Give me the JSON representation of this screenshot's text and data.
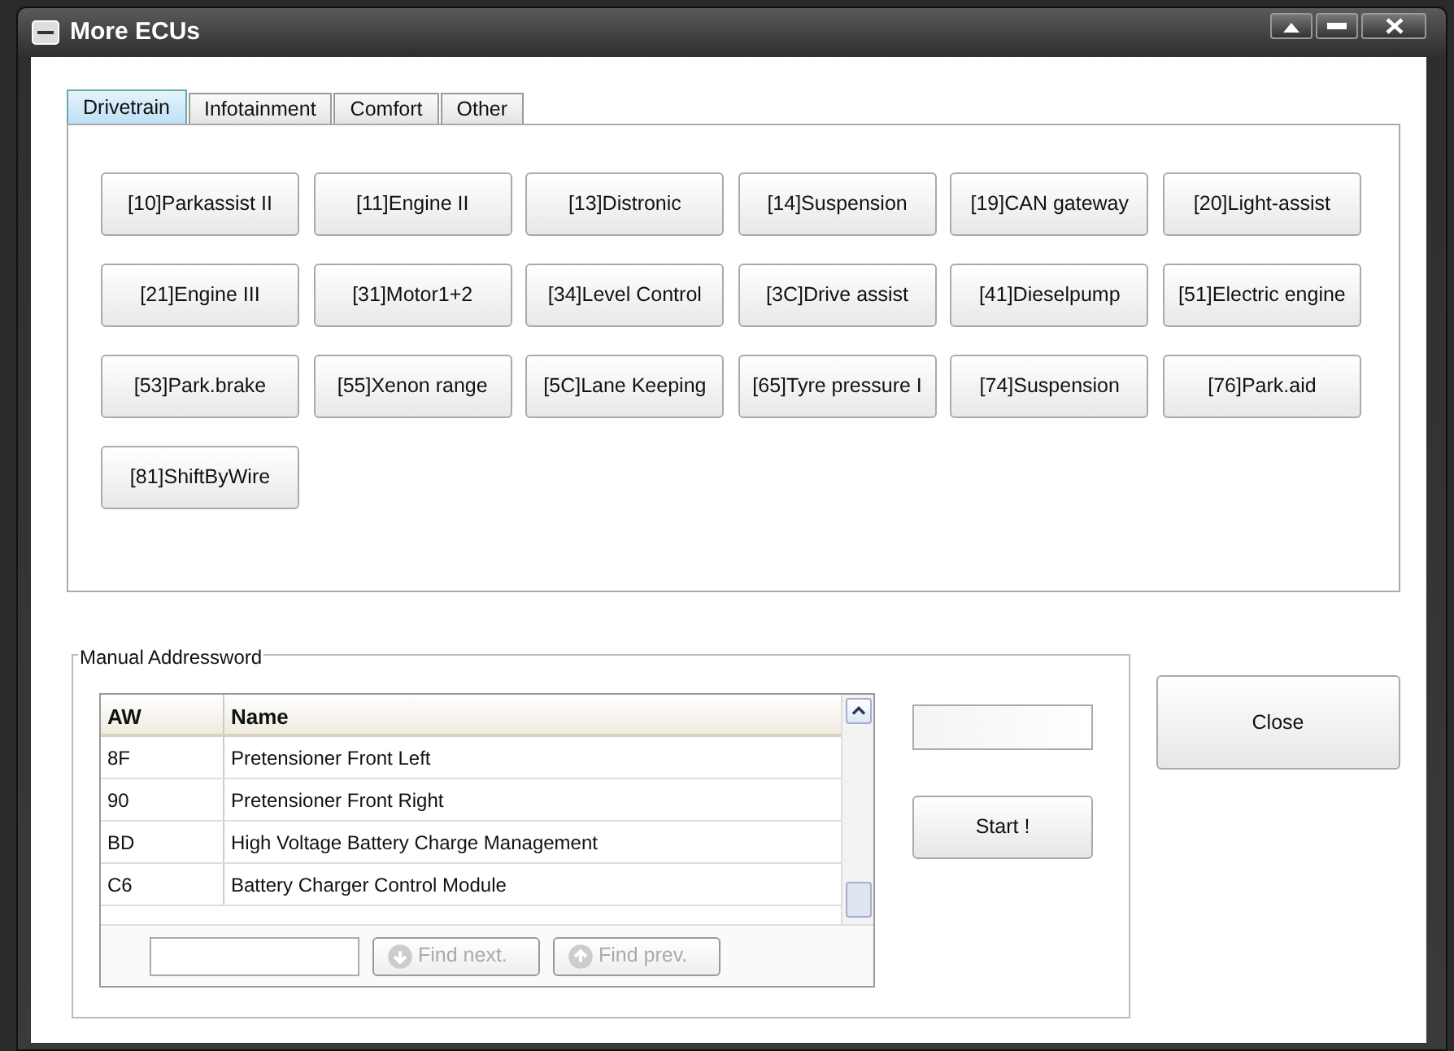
{
  "window": {
    "title": "More ECUs"
  },
  "tabs": [
    {
      "label": "Drivetrain",
      "selected": true
    },
    {
      "label": "Infotainment",
      "selected": false
    },
    {
      "label": "Comfort",
      "selected": false
    },
    {
      "label": "Other",
      "selected": false
    }
  ],
  "ecu_buttons": [
    "[10]Parkassist II",
    "[11]Engine II",
    "[13]Distronic",
    "[14]Suspension",
    "[19]CAN gateway",
    "[20]Light-assist",
    "[21]Engine III",
    "[31]Motor1+2",
    "[34]Level Control",
    "[3C]Drive assist",
    "[41]Dieselpump",
    "[51]Electric engine",
    "[53]Park.brake",
    "[55]Xenon range",
    "[5C]Lane Keeping",
    "[65]Tyre pressure I",
    "[74]Suspension",
    "[76]Park.aid",
    "[81]ShiftByWire"
  ],
  "manual": {
    "title": "Manual Addressword",
    "table": {
      "columns": [
        "AW",
        "Name"
      ],
      "rows": [
        [
          "8F",
          "Pretensioner Front Left"
        ],
        [
          "90",
          "Pretensioner Front Right"
        ],
        [
          "BD",
          "High Voltage Battery Charge Management"
        ],
        [
          "C6",
          "Battery Charger Control Module"
        ]
      ]
    },
    "find_buttons": [
      {
        "label": "Find next.",
        "kind": "down",
        "disabled": true
      },
      {
        "label": "Find prev.",
        "kind": "up",
        "disabled": true
      }
    ],
    "start_button": "Start !"
  },
  "close_button": "Close"
}
